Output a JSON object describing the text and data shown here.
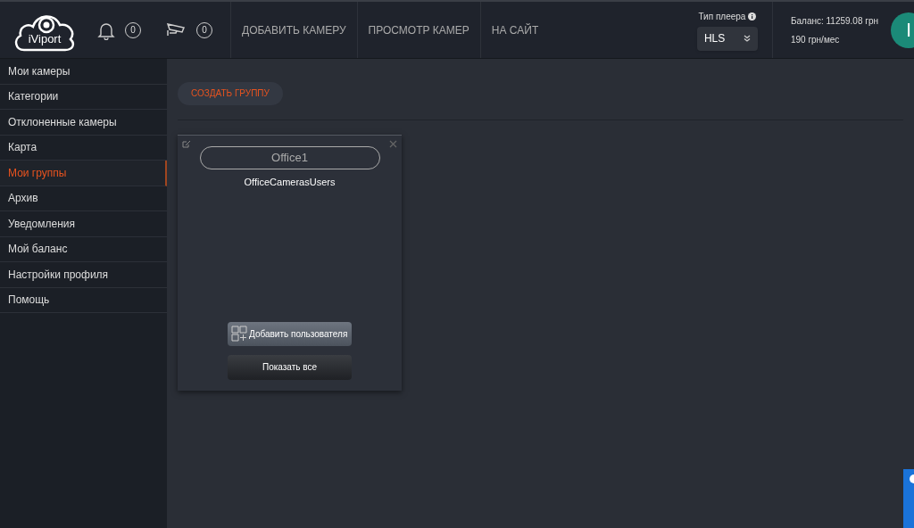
{
  "header": {
    "logo": "iViport",
    "notifications": {
      "count": "0"
    },
    "cameras": {
      "count": "0"
    },
    "nav": [
      {
        "label": "ДОБАВИТЬ КАМЕРУ"
      },
      {
        "label": "ПРОСМОТР КАМЕР"
      },
      {
        "label": "НА САЙТ"
      }
    ],
    "player": {
      "label": "Тип плеера",
      "value": "HLS"
    },
    "balance": "Баланс: 11259.08 грн",
    "tariff": "190 грн/мес",
    "avatar": "I"
  },
  "sidebar": {
    "items": [
      {
        "label": "Мои камеры",
        "selected": false
      },
      {
        "label": "Категории",
        "selected": false
      },
      {
        "label": "Отклоненные камеры",
        "selected": false
      },
      {
        "label": "Карта",
        "selected": false
      },
      {
        "label": "Мои группы",
        "selected": true
      },
      {
        "label": "Архив",
        "selected": false
      },
      {
        "label": "Уведомления",
        "selected": false
      },
      {
        "label": "Мой баланс",
        "selected": false
      },
      {
        "label": "Настройки профиля",
        "selected": false
      },
      {
        "label": "Помощь",
        "selected": false
      }
    ]
  },
  "create_group_button": "СОЗДАТЬ ГРУППУ",
  "groups": [
    {
      "name": "Office1",
      "users": "OfficeCamerasUsers",
      "add_user_button": "Добавить пользователя",
      "show_all_button": "Показать все"
    }
  ]
}
